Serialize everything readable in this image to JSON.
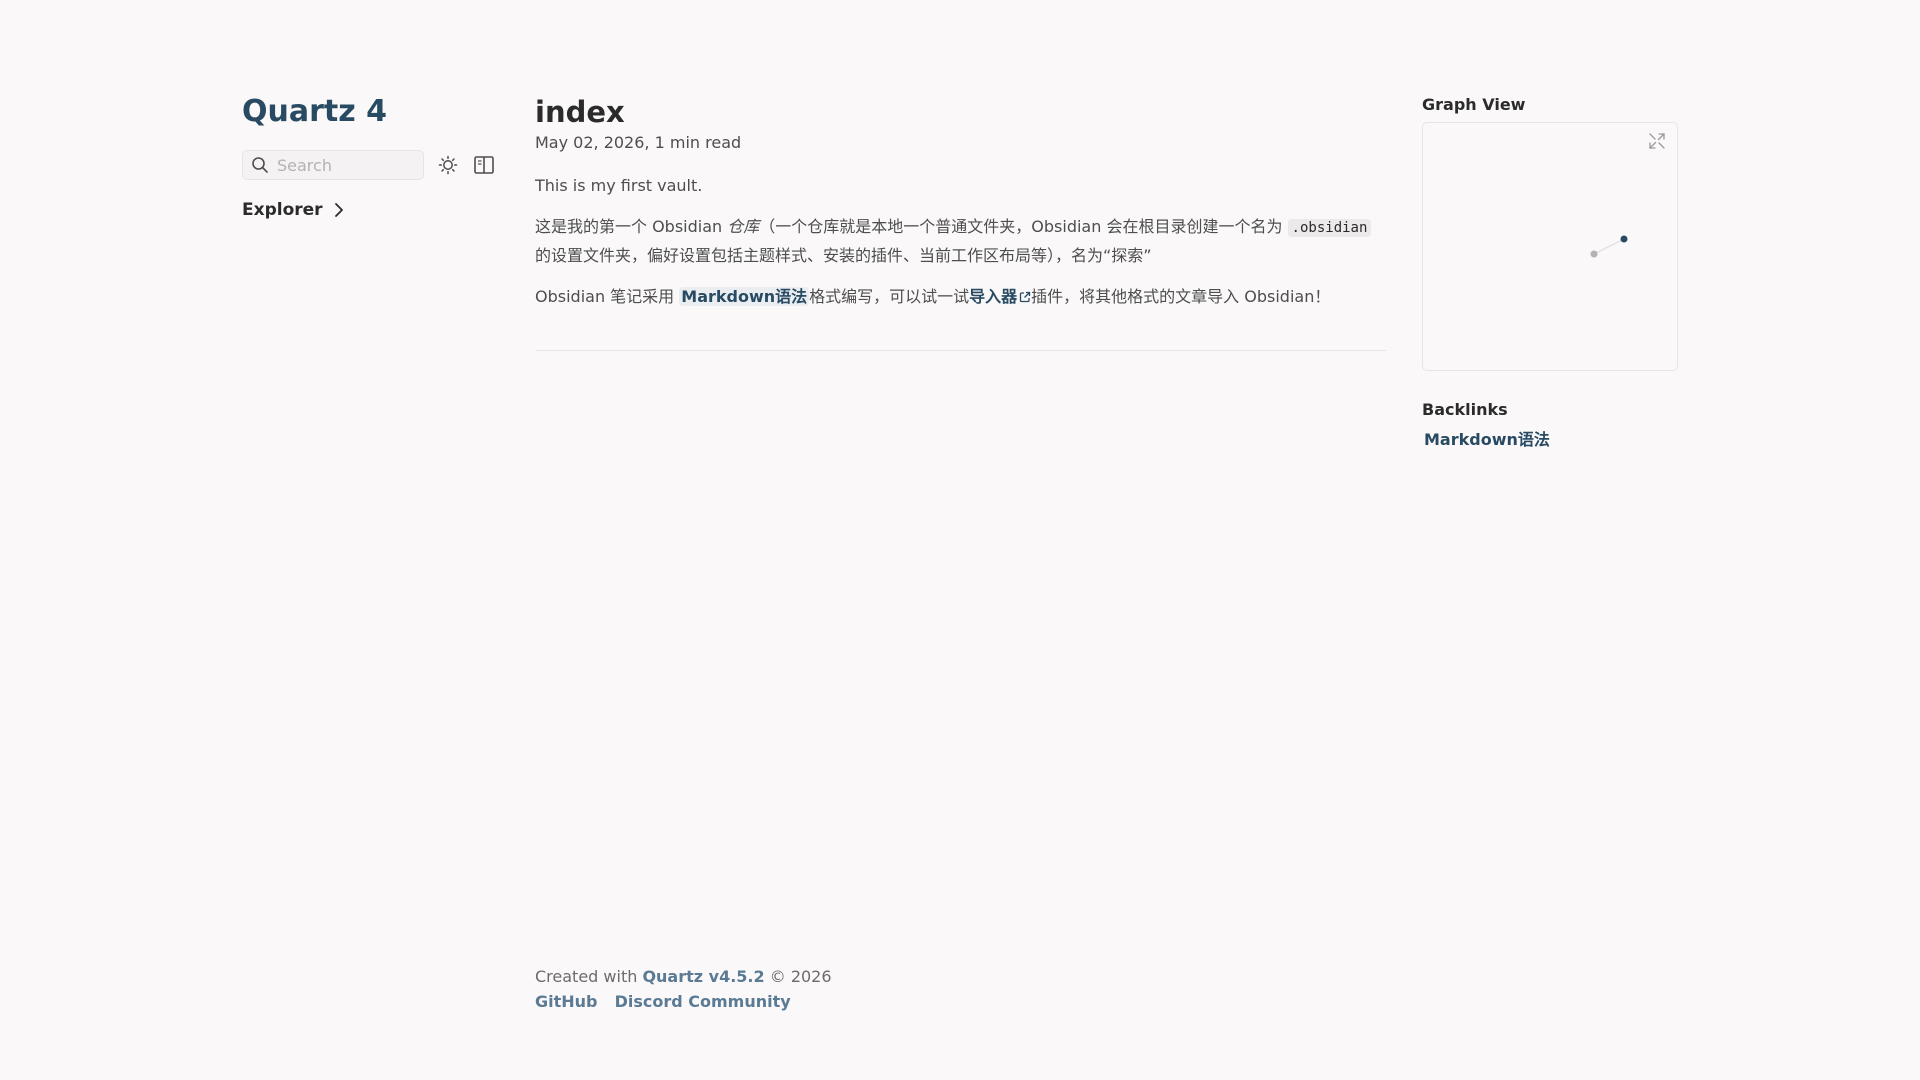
{
  "site": {
    "title": "Quartz 4"
  },
  "search": {
    "placeholder": "Search"
  },
  "icons": {
    "search": "search-icon",
    "theme": "sun-icon",
    "reader": "book-icon",
    "chevron": "chevron-right-icon",
    "expand": "expand-icon",
    "external": "external-link-icon"
  },
  "explorer": {
    "label": "Explorer"
  },
  "article": {
    "title": "index",
    "date": "May 02, 2026",
    "separator": ",",
    "read_time": "1 min read",
    "p1": "This is my first vault.",
    "p2_a": "这是我的第一个 Obsidian ",
    "p2_em": "仓库",
    "p2_b": "（一个仓库就是本地一个普通文件夹，Obsidian 会在根目录创建一个名为 ",
    "p2_code": ".obsidian",
    "p2_c": " 的设置文件夹，偏好设置包括主题样式、安装的插件、当前工作区布局等），名为“探索”",
    "p3_a": "Obsidian 笔记采用 ",
    "p3_link": "Markdown语法",
    "p3_b": "格式编写，可以试一试",
    "p3_ext": "导入器",
    "p3_c": "插件，将其他格式的文章导入 Obsidian！"
  },
  "graph": {
    "title": "Graph View",
    "node_color_current": "#284b63",
    "node_color_other": "#b3b3b3"
  },
  "backlinks": {
    "title": "Backlinks",
    "items": [
      "Markdown语法"
    ]
  },
  "footer": {
    "created_prefix": "Created with ",
    "quartz_version": "Quartz v4.5.2",
    "copyright": " © 2026",
    "links": [
      "GitHub",
      "Discord Community"
    ]
  },
  "colors": {
    "accent": "#284b63",
    "background": "#faf8f8",
    "text": "#4e4e4e"
  }
}
